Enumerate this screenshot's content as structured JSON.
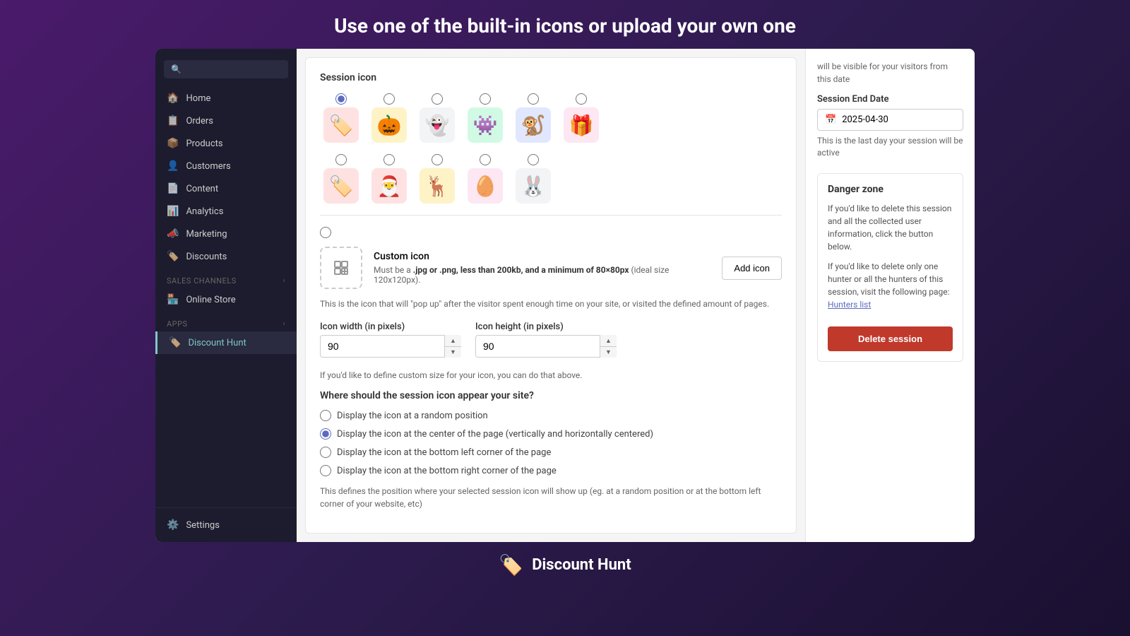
{
  "header": {
    "title": "Use one of the built-in icons or upload your own one"
  },
  "sidebar": {
    "items": [
      {
        "id": "home",
        "label": "Home",
        "icon": "🏠"
      },
      {
        "id": "orders",
        "label": "Orders",
        "icon": "📋"
      },
      {
        "id": "products",
        "label": "Products",
        "icon": "📦"
      },
      {
        "id": "customers",
        "label": "Customers",
        "icon": "👤"
      },
      {
        "id": "content",
        "label": "Content",
        "icon": "📄"
      },
      {
        "id": "analytics",
        "label": "Analytics",
        "icon": "📊"
      },
      {
        "id": "marketing",
        "label": "Marketing",
        "icon": "📣"
      },
      {
        "id": "discounts",
        "label": "Discounts",
        "icon": "🏷️"
      }
    ],
    "sales_channels_label": "Sales channels",
    "online_store": "Online Store",
    "apps_label": "Apps",
    "discount_hunt": "Discount Hunt",
    "settings": "Settings"
  },
  "main": {
    "session_icon_label": "Session icon",
    "icons": [
      {
        "id": "icon1",
        "emoji": "🏷️",
        "bg": "#fee2e2",
        "selected": true
      },
      {
        "id": "icon2",
        "emoji": "🎃",
        "bg": "#fef3c7",
        "selected": false
      },
      {
        "id": "icon3",
        "emoji": "👻",
        "bg": "#f3f4f6",
        "selected": false
      },
      {
        "id": "icon4",
        "emoji": "👾",
        "bg": "#d1fae5",
        "selected": false
      },
      {
        "id": "icon5",
        "emoji": "🐒",
        "bg": "#e0e7ff",
        "selected": false
      },
      {
        "id": "icon6",
        "emoji": "🎁",
        "bg": "#fce7f3",
        "selected": false
      },
      {
        "id": "icon7",
        "emoji": "🏷️",
        "bg": "#fee2e2",
        "selected": false
      },
      {
        "id": "icon8",
        "emoji": "🎅",
        "bg": "#fee2e2",
        "selected": false
      },
      {
        "id": "icon9",
        "emoji": "🦌",
        "bg": "#fef3c7",
        "selected": false
      },
      {
        "id": "icon10",
        "emoji": "🥚",
        "bg": "#fce7f3",
        "selected": false
      },
      {
        "id": "icon11",
        "emoji": "🐰",
        "bg": "#f3f4f6",
        "selected": false
      }
    ],
    "custom_icon_label": "Custom icon",
    "custom_icon_desc": "Must be a .jpg or .png, less than 200kb, and a minimum of 80×80px",
    "custom_icon_desc2": "(ideal size 120x120px).",
    "add_icon_btn": "Add icon",
    "popup_info": "This is the icon that will \"pop up\" after the visitor spent enough time on your site, or visited the defined amount of pages.",
    "icon_width_label": "Icon width (in pixels)",
    "icon_height_label": "Icon height (in pixels)",
    "icon_width_value": "90",
    "icon_height_value": "90",
    "size_hint": "If you'd like to define custom size for your icon, you can do that above.",
    "position_question": "Where should the session icon appear your site?",
    "position_options": [
      {
        "id": "pos1",
        "label": "Display the icon at a random position",
        "selected": false
      },
      {
        "id": "pos2",
        "label": "Display the icon at the center of the page (vertically and horizontally centered)",
        "selected": true
      },
      {
        "id": "pos3",
        "label": "Display the icon at the bottom left corner of the page",
        "selected": false
      },
      {
        "id": "pos4",
        "label": "Display the icon at the bottom right corner of the page",
        "selected": false
      }
    ],
    "position_hint": "This defines the position where your selected session icon will show up (eg. at a random position or at the bottom left corner of your website, etc)"
  },
  "right_panel": {
    "visible_text": "will be visible for your visitors from this date",
    "session_end_date_label": "Session End Date",
    "session_end_date_value": "2025-04-30",
    "session_end_date_hint": "This is the last day your session will be active",
    "danger_zone_title": "Danger zone",
    "danger_text1": "If you'd like to delete this session and all the collected user information, click the button below.",
    "danger_text2": "If you'd like to delete only one hunter or all the hunters of this session, visit the following page:",
    "hunters_list_link": "Hunters list",
    "delete_btn_label": "Delete session"
  },
  "footer": {
    "icon": "🏷️",
    "label": "Discount Hunt"
  }
}
